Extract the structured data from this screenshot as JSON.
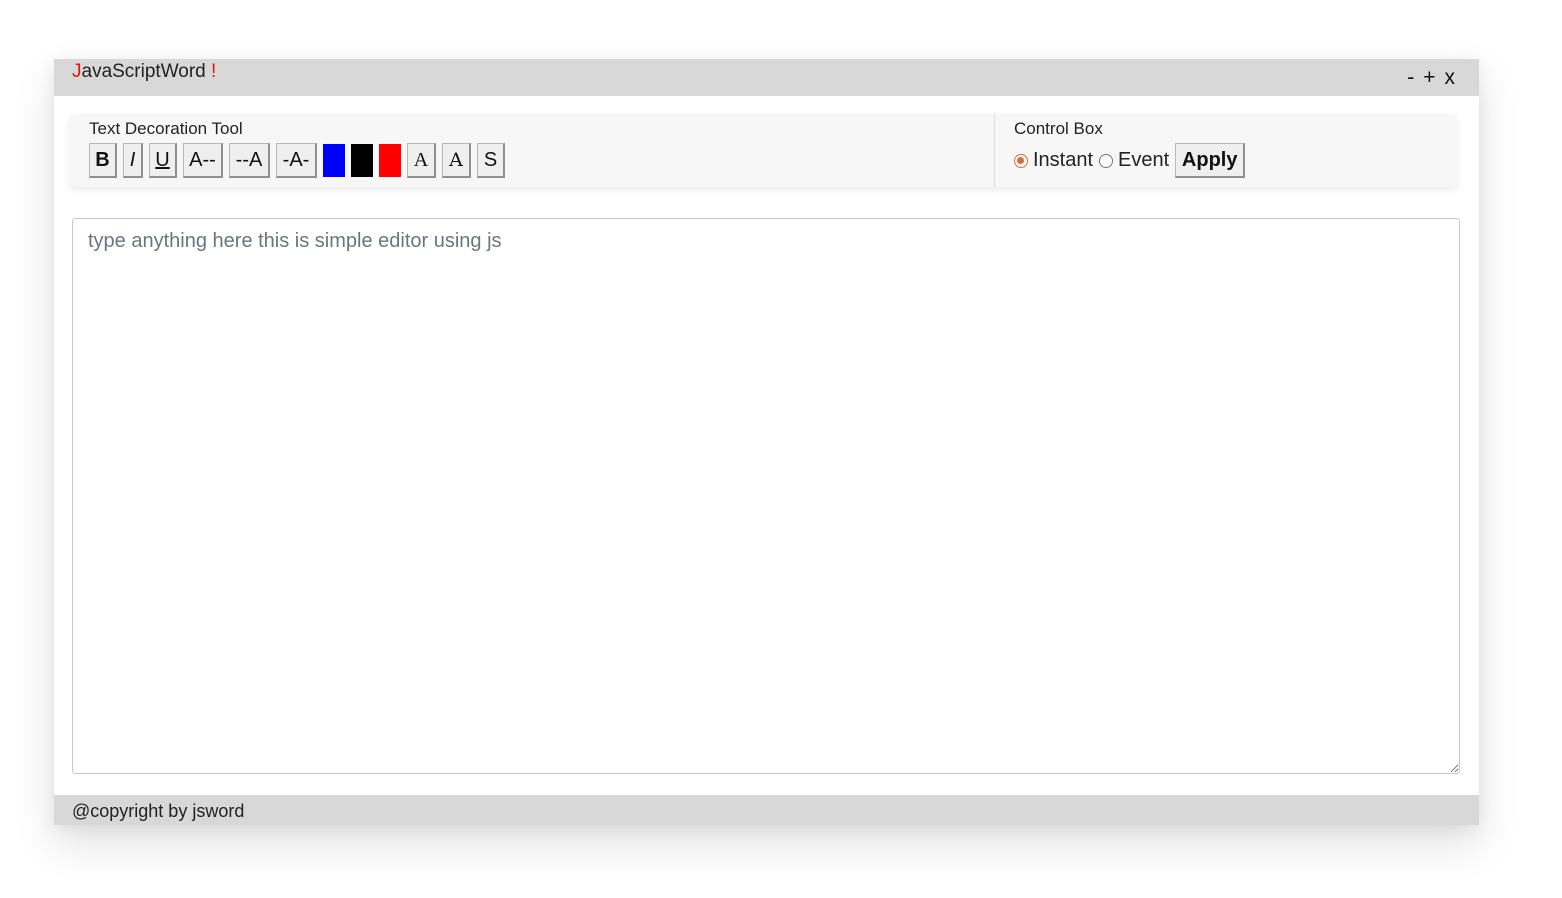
{
  "window": {
    "title_first_letter": "J",
    "title_rest": "avaScriptWord ",
    "title_suffix": "!",
    "controls": {
      "minimize": "-",
      "maximize": "+",
      "close": "x"
    }
  },
  "tools": {
    "title": "Text Decoration Tool",
    "bold": "B",
    "italic": "I",
    "underline": "U",
    "align_left": "A--",
    "align_right": "--A",
    "align_center": "-A-",
    "colors": [
      "#0000ff",
      "#000000",
      "#ff0000"
    ],
    "font_a1": "A",
    "font_a2": "A",
    "font_s": "S"
  },
  "control": {
    "title": "Control Box",
    "instant_label": "Instant",
    "event_label": "Event",
    "selected": "instant",
    "apply_label": "Apply"
  },
  "editor": {
    "placeholder": "type anything here this is simple editor using js",
    "value": ""
  },
  "footer": {
    "text": "@copyright by jsword"
  }
}
